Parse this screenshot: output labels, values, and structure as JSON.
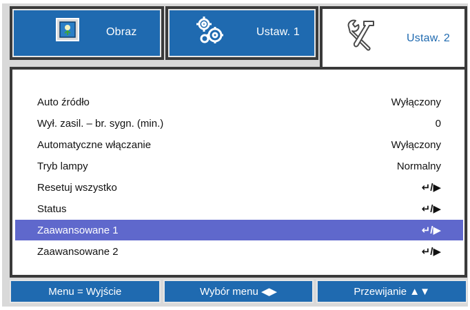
{
  "tabs": [
    {
      "label": "Obraz",
      "icon": "picture-icon",
      "active": false
    },
    {
      "label": "Ustaw. 1",
      "icon": "gears-icon",
      "active": false
    },
    {
      "label": "Ustaw. 2",
      "icon": "tools-icon",
      "active": true
    }
  ],
  "menu": {
    "items": [
      {
        "label": "Auto źródło",
        "value": "Wyłączony",
        "selected": false
      },
      {
        "label": "Wył. zasil. – br. sygn. (min.)",
        "value": "0",
        "selected": false
      },
      {
        "label": "Automatyczne włączanie",
        "value": "Wyłączony",
        "selected": false
      },
      {
        "label": "Tryb lampy",
        "value": "Normalny",
        "selected": false
      },
      {
        "label": "Resetuj wszystko",
        "value": "↵/▶",
        "selected": false
      },
      {
        "label": "Status",
        "value": "↵/▶",
        "selected": false
      },
      {
        "label": "Zaawansowane 1",
        "value": "↵/▶",
        "selected": true
      },
      {
        "label": "Zaawansowane 2",
        "value": "↵/▶",
        "selected": false
      }
    ]
  },
  "footer": {
    "exit": "Menu = Wyjście",
    "select": "Wybór menu ◀▶",
    "scroll": "Przewijanie ▲▼"
  },
  "colors": {
    "tab_blue": "#1f6ab0",
    "highlight": "#5f68cc",
    "frame": "#3a3a3a"
  }
}
